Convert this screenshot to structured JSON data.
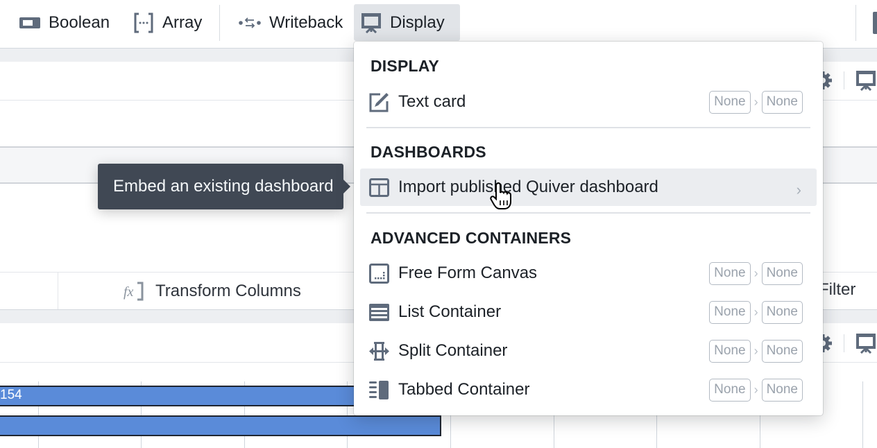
{
  "toolbar": {
    "buttons": [
      {
        "label": "Boolean",
        "icon": "boolean-toggle-icon"
      },
      {
        "label": "Array",
        "icon": "array-brackets-icon"
      },
      {
        "label": "Writeback",
        "icon": "writeback-arrows-icon"
      },
      {
        "label": "Display",
        "icon": "presentation-icon",
        "active": true
      }
    ]
  },
  "background": {
    "transform_columns_label": "Transform Columns",
    "filter_label": "Filter",
    "chart": {
      "bar_label": "154",
      "color": "#5a8bd9"
    }
  },
  "tooltip": {
    "text": "Embed an existing dashboard"
  },
  "menu": {
    "sections": [
      {
        "heading": "DISPLAY",
        "items": [
          {
            "label": "Text card",
            "icon": "edit-icon",
            "from": "None",
            "to": "None"
          }
        ]
      },
      {
        "heading": "DASHBOARDS",
        "items": [
          {
            "label": "Import published Quiver dashboard",
            "icon": "dashboard-layout-icon",
            "submenu": true,
            "hovered": true
          }
        ]
      },
      {
        "heading": "ADVANCED CONTAINERS",
        "items": [
          {
            "label": "Free Form Canvas",
            "icon": "canvas-icon",
            "from": "None",
            "to": "None"
          },
          {
            "label": "List Container",
            "icon": "list-icon",
            "from": "None",
            "to": "None"
          },
          {
            "label": "Split Container",
            "icon": "split-icon",
            "from": "None",
            "to": "None"
          },
          {
            "label": "Tabbed Container",
            "icon": "tabs-icon",
            "from": "None",
            "to": "None"
          }
        ]
      }
    ]
  },
  "colors": {
    "accent_bar": "#5a8bd9",
    "tooltip_bg": "#404854",
    "icon": "#5f6b7c"
  }
}
